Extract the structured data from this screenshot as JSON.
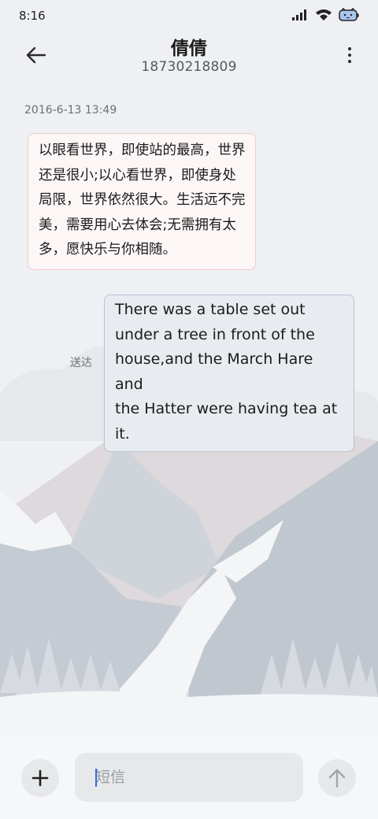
{
  "status_bar": {
    "time": "8:16",
    "icons": [
      "signal-icon",
      "wifi-icon",
      "battery-icon"
    ]
  },
  "header": {
    "contact_name": "倩倩",
    "contact_number": "18730218809",
    "back_icon": "arrow-left-icon",
    "menu_icon": "more-vertical-icon"
  },
  "conversation": {
    "timestamp": "2016-6-13 13:49",
    "received_message": {
      "lines": [
        "以眼看世界，即使站的最高，世界",
        "还是很小;以心看世界，即使身处",
        "局限，世界依然很大。生活远不完",
        "美，需要用心去体会;无需拥有太",
        "多，愿快乐与你相随。"
      ]
    },
    "sent_message": {
      "lines": [
        "There was a table set out",
        "under a tree in front of the",
        "house,and the March Hare and",
        "the Hatter were having tea at",
        "it."
      ],
      "status": "送达"
    }
  },
  "composer": {
    "placeholder": "短信",
    "value": "",
    "add_icon": "plus-icon",
    "send_icon": "arrow-up-icon"
  },
  "colors": {
    "received_bubble_bg": "#fdf6f6",
    "received_bubble_border": "#f0c9c9",
    "sent_bubble_bg": "#e8ebf0",
    "sent_bubble_border": "#b9c2d4",
    "background": "#eef0f3"
  }
}
